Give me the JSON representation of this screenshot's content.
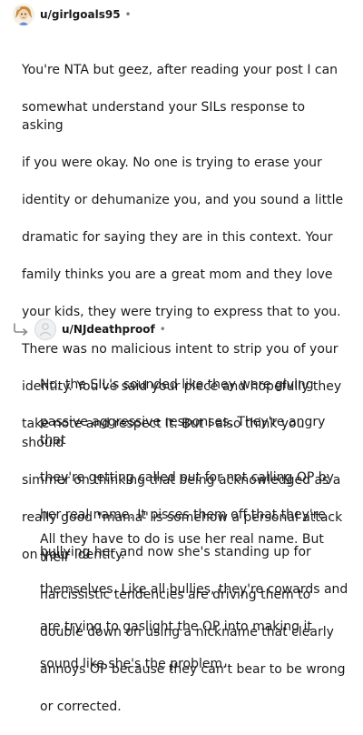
{
  "comments": [
    {
      "username": "u/girlgoals95",
      "separator": "•",
      "avatar_icon": "cartoon-character-avatar",
      "body_lines": [
        "You're NTA but geez, after reading your post I can",
        "somewhat understand your SILs response to asking",
        "if you were okay. No one is trying to erase your",
        "identity or dehumanize you, and you sound a little",
        "dramatic for saying they are in this context. Your",
        "family thinks you are a great mom and they love",
        "your kids, they were trying to express that to you.",
        "There was no malicious intent to strip you of your",
        "identity. You've said your piece and hopefully they",
        "take note and respect it. But I also think you should",
        "simmer on thinking that being acknowledged as a",
        "really good \"mama\" is somehow a personal attack",
        "on your identity."
      ]
    },
    {
      "username": "u/NJdeathproof",
      "separator": "•",
      "avatar_icon": "default-snoo-avatar",
      "reply_icon": "reply-arrow-icon",
      "paragraphs": [
        [
          "No, the SIL's sounded like they were giving",
          "passive aggressive responses. They're angry that",
          "they're getting called out for not calling OP by",
          "her real name. It pisses them off that they're",
          "bullying her and now she's standing up for",
          "themselves. Like all bullies, they're cowards and",
          "are trying to gaslight the OP into making it",
          "sound like she's the problem."
        ],
        [
          "All they have to do is use her real name. But their",
          "narcissistic tendencies are driving them to",
          "double down on using a nickname that clearly",
          "annoys OP because they can't bear to be wrong",
          "or corrected."
        ]
      ]
    }
  ]
}
